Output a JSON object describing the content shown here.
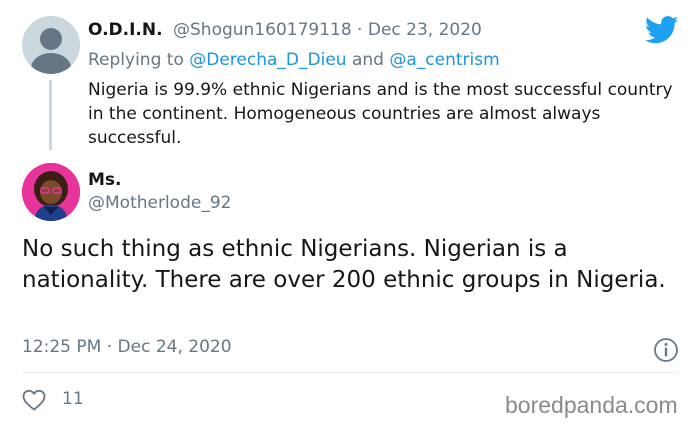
{
  "original_tweet": {
    "display_name": "O.D.I.N.",
    "handle_and_date": "@Shogun160179118 · Dec 23, 2020",
    "replying_prefix": "Replying to ",
    "mention_1": "@Derecha_D_Dieu",
    "replying_and": " and ",
    "mention_2": "@a_centrism",
    "text": "Nigeria is 99.9% ethnic Nigerians and is the most successful country in the continent. Homogeneous countries are almost always successful."
  },
  "reply_tweet": {
    "display_name": "Ms.",
    "handle": "@Motherlode_92",
    "text": "No such thing as ethnic Nigerians. Nigerian is a nationality. There are over 200 ethnic groups in Nigeria.",
    "timestamp": "12:25 PM · Dec 24, 2020",
    "like_count": "11"
  },
  "watermark": "boredpanda.com",
  "colors": {
    "twitter_blue": "#1da1f2",
    "mention_blue": "#1b95e0",
    "secondary_text": "#657786"
  },
  "icons": {
    "brand": "twitter-bird-icon",
    "info": "info-icon",
    "like": "heart-icon"
  }
}
